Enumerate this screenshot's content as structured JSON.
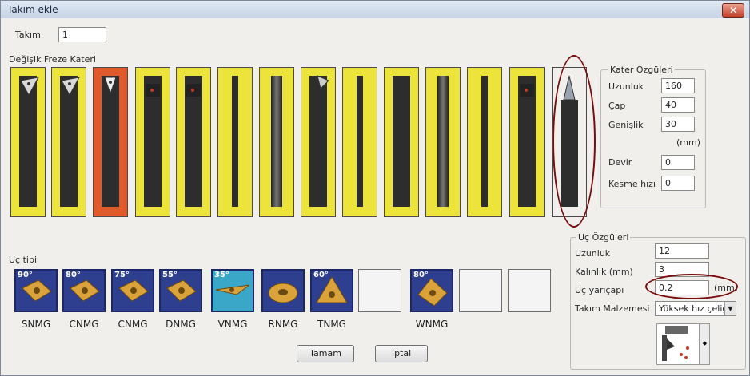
{
  "window": {
    "title": "Takım ekle",
    "close_label": "✕"
  },
  "tool": {
    "label": "Takım",
    "value": "1"
  },
  "cutting_tools": {
    "label": "Değişik Freze Kateri",
    "items": [
      {
        "shape": "triangle-insert"
      },
      {
        "shape": "triangle-insert"
      },
      {
        "shape": "pointed-insert",
        "selected": true
      },
      {
        "shape": "square-insert"
      },
      {
        "shape": "square-insert"
      },
      {
        "shape": "thin-bar"
      },
      {
        "shape": "drill"
      },
      {
        "shape": "boring"
      },
      {
        "shape": "thin-bar"
      },
      {
        "shape": "parting"
      },
      {
        "shape": "tap"
      },
      {
        "shape": "thin-bar"
      },
      {
        "shape": "square-insert"
      },
      {
        "shape": "empty-pointed"
      }
    ]
  },
  "tool_props": {
    "title": "Kater Özgüleri",
    "length_label": "Uzunluk",
    "length_value": "160",
    "diameter_label": "Çap",
    "diameter_value": "40",
    "width_label": "Genişlik",
    "width_value": "30",
    "unit": "(mm)",
    "speed_label": "Devir",
    "speed_value": "0",
    "cut_speed_label": "Kesme hızı",
    "cut_speed_value": "0"
  },
  "insert": {
    "label": "Uç tipi",
    "items": [
      {
        "angle": "90°",
        "name": "SNMG",
        "filled": true
      },
      {
        "angle": "80°",
        "name": "CNMG",
        "filled": true
      },
      {
        "angle": "75°",
        "name": "CNMG",
        "filled": true
      },
      {
        "angle": "55°",
        "name": "DNMG",
        "filled": true
      },
      {
        "angle": "35°",
        "name": "VNMG",
        "filled": true,
        "cyan": true
      },
      {
        "angle": "",
        "name": "RNMG",
        "filled": true
      },
      {
        "angle": "60°",
        "name": "TNMG",
        "filled": true
      },
      {
        "angle": "",
        "name": "",
        "filled": false
      },
      {
        "angle": "80°",
        "name": "WNMG",
        "filled": true
      },
      {
        "angle": "",
        "name": "",
        "filled": false
      },
      {
        "angle": "",
        "name": "",
        "filled": false
      }
    ]
  },
  "insert_props": {
    "title": "Uç Özgüleri",
    "length_label": "Uzunluk",
    "length_value": "12",
    "thickness_label": "Kalınlık (mm)",
    "thickness_value": "3",
    "radius_label": "Uç yarıçapı",
    "radius_value": "0.2",
    "radius_unit": "(mm)",
    "material_label": "Takım Malzemesi",
    "material_value": "Yüksek hız çeliği"
  },
  "buttons": {
    "ok": "Tamam",
    "cancel": "İptal"
  }
}
